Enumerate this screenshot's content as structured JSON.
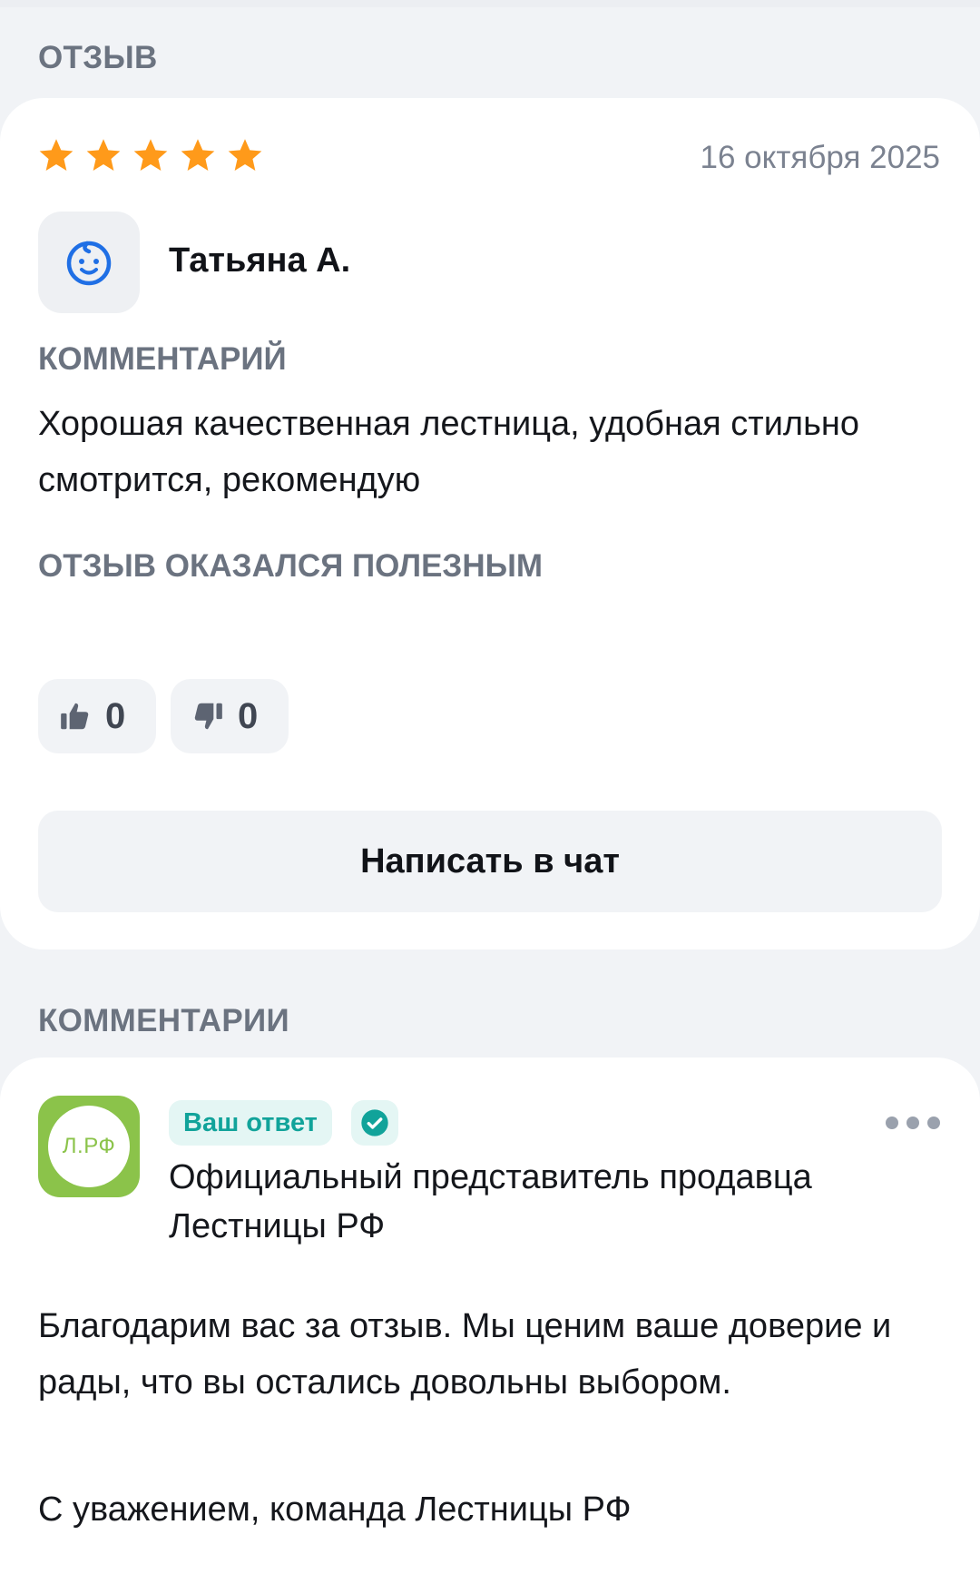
{
  "review_section": {
    "heading": "ОТЗЫВ",
    "rating": 5,
    "rating_max": 5,
    "date": "16 октября 2025",
    "author": {
      "name": "Татьяна А.",
      "avatar_icon": "baby-face-icon"
    },
    "comment_heading": "КОММЕНТАРИЙ",
    "comment_text": "Хорошая качественная лестница, удобная стильно смотрится, рекомендую",
    "helpful_heading": "ОТЗЫВ ОКАЗАЛСЯ ПОЛЕЗНЫМ",
    "votes": {
      "likes": "0",
      "dislikes": "0"
    },
    "chat_button_label": "Написать в чат"
  },
  "comments_section": {
    "heading": "КОММЕНТАРИИ",
    "reply": {
      "logo_text": "Л.РФ",
      "badge_label": "Ваш ответ",
      "verified_icon": "check-circle-icon",
      "author_title": "Официальный представитель продавца Лестницы РФ",
      "text": "Благодарим вас за отзыв. Мы ценим ваше доверие и рады, что вы остались довольны выбором.",
      "signature": "С уважением, команда Лестницы РФ"
    }
  },
  "colors": {
    "star": "#ff9a1a",
    "accent_teal": "#11a39a",
    "avatar_icon": "#1f6fe5",
    "seller_logo": "#8bc34a",
    "page_bg": "#f1f3f6"
  }
}
